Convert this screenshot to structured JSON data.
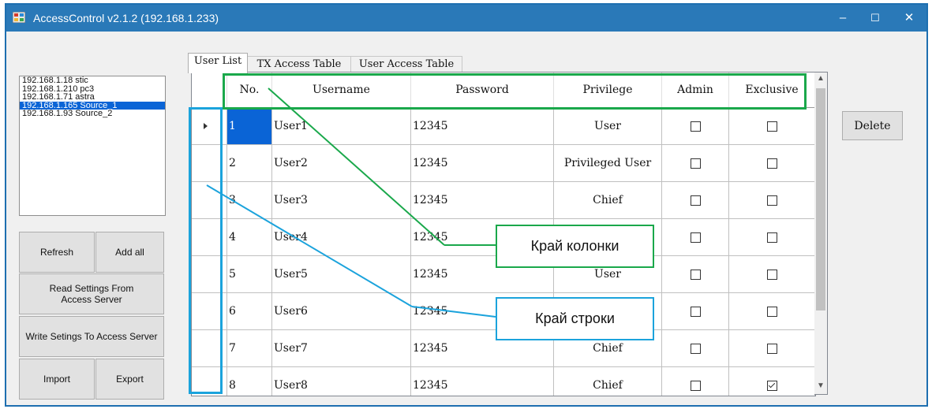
{
  "window": {
    "title": "AccessControl v2.1.2 (192.168.1.233)",
    "controls": {
      "minimize": "–",
      "maximize": "☐",
      "close": "✕"
    },
    "title_bar_color": "#2a79b8"
  },
  "connections": [
    {
      "label": "192.168.1.18 stic",
      "selected": false
    },
    {
      "label": "192.168.1.210 pc3",
      "selected": false
    },
    {
      "label": "192.168.1.71 astra",
      "selected": false
    },
    {
      "label": "192.168.1.165 Source_1",
      "selected": true
    },
    {
      "label": "192.168.1.93 Source_2",
      "selected": false
    }
  ],
  "buttons": {
    "refresh": "Refresh",
    "add_all": "Add all",
    "read_settings": "Read Settings From Access Server",
    "write_settings": "Write Setings To Access Server",
    "import": "Import",
    "export": "Export",
    "delete": "Delete"
  },
  "tabs": [
    {
      "label": "User List",
      "active": true
    },
    {
      "label": "TX Access Table",
      "active": false
    },
    {
      "label": "User Access Table",
      "active": false
    }
  ],
  "table": {
    "columns": [
      "No.",
      "Username",
      "Password",
      "Privilege",
      "Admin",
      "Exclusive"
    ],
    "rows": [
      {
        "no": "1",
        "username": "User1",
        "password": "12345",
        "privilege": "User",
        "admin": false,
        "exclusive": false,
        "current": true
      },
      {
        "no": "2",
        "username": "User2",
        "password": "12345",
        "privilege": "Privileged User",
        "admin": false,
        "exclusive": false
      },
      {
        "no": "3",
        "username": "User3",
        "password": "12345",
        "privilege": "Chief",
        "admin": false,
        "exclusive": false
      },
      {
        "no": "4",
        "username": "User4",
        "password": "12345",
        "privilege": "",
        "admin": false,
        "exclusive": false
      },
      {
        "no": "5",
        "username": "User5",
        "password": "12345",
        "privilege": "User",
        "admin": false,
        "exclusive": false
      },
      {
        "no": "6",
        "username": "User6",
        "password": "12345",
        "privilege": "",
        "admin": false,
        "exclusive": false
      },
      {
        "no": "7",
        "username": "User7",
        "password": "12345",
        "privilege": "Chief",
        "admin": false,
        "exclusive": false
      },
      {
        "no": "8",
        "username": "User8",
        "password": "12345",
        "privilege": "Chief",
        "admin": false,
        "exclusive": true
      }
    ]
  },
  "annotations": {
    "column_edge": "Край колонки",
    "row_edge": "Край строки",
    "green": "#1aa84b",
    "blue": "#1ba3dc"
  },
  "colors": {
    "selection": "#0a64d6"
  },
  "icons": {
    "app": "app-icon",
    "current_row": "row-pointer-icon",
    "scroll_up": "scroll-up-icon",
    "scroll_down": "scroll-down-icon"
  }
}
